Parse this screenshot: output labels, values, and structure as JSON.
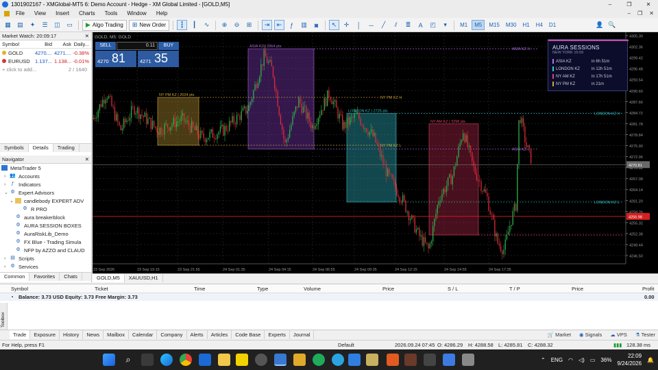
{
  "window": {
    "title": "1301902167 - XMGlobal-MT5 6: Demo Account - Hedge - XM Global Limited - [GOLD,M5]",
    "controls": [
      "–",
      "❐",
      "✕"
    ]
  },
  "menu": [
    "File",
    "View",
    "Insert",
    "Charts",
    "Tools",
    "Window",
    "Help"
  ],
  "toolbar": {
    "algo_label": "Algo Trading",
    "new_order_label": "New Order",
    "timeframes": [
      "M1",
      "M5",
      "M15",
      "M30",
      "H1",
      "H4",
      "D1"
    ],
    "active_tf": "M5"
  },
  "market_watch": {
    "title": "Market Watch: 20:09:17",
    "headers": [
      "Symbol",
      "Bid",
      "Ask",
      "Daily..."
    ],
    "rows": [
      {
        "symbol": "GOLD",
        "bid": "4270....",
        "ask": "4271....",
        "daily": "-0.38%"
      },
      {
        "symbol": "EURUSD",
        "bid": "1.137...",
        "ask": "1.138...",
        "daily": "-0.01%"
      }
    ],
    "add_label": "+ click to add...",
    "count": "2 / 1640",
    "tabs": [
      "Symbols",
      "Details",
      "Trading"
    ]
  },
  "navigator": {
    "title": "Navigator",
    "items": [
      {
        "label": "MetaTrader 5",
        "indent": 0
      },
      {
        "label": "Accounts",
        "indent": 1
      },
      {
        "label": "Indicators",
        "indent": 1
      },
      {
        "label": "Expert Advisors",
        "indent": 1
      },
      {
        "label": "candlebody EXPERT ADV",
        "indent": 2
      },
      {
        "label": "R PRO",
        "indent": 3
      },
      {
        "label": "aura breakerblock",
        "indent": 2
      },
      {
        "label": "AURA SESSION BOXES",
        "indent": 2
      },
      {
        "label": "AuraRiskLib_Demo",
        "indent": 2
      },
      {
        "label": "FX Blue - Trading Simula",
        "indent": 2
      },
      {
        "label": "NFP by AZZO and CLAUD",
        "indent": 2
      },
      {
        "label": "Scripts",
        "indent": 1
      },
      {
        "label": "Services",
        "indent": 1
      }
    ],
    "tabs": [
      "Common",
      "Favorites",
      "Chats"
    ]
  },
  "chart": {
    "symbol_label": "GOLD, M5:  GOLD",
    "sell_label": "SELL",
    "buy_label": "BUY",
    "lot": "0.11",
    "sell_price_small": "4270",
    "sell_price_big": "81",
    "buy_price_small": "4271",
    "buy_price_big": "35",
    "price_ticks": [
      "4305.30",
      "4302.36",
      "4299.42",
      "4296.48",
      "4293.54",
      "4290.60",
      "4287.66",
      "4284.72",
      "4281.78",
      "4278.84",
      "4275.90",
      "4272.96",
      "4270.02",
      "4267.08",
      "4264.14",
      "4261.20",
      "4258.26",
      "4255.32",
      "4252.38",
      "4249.44",
      "4246.50"
    ],
    "current_price": "4270.81",
    "red_price": "4256.98",
    "time_ticks": [
      "23 Sep 2026",
      "23 Sep 19:15",
      "23 Sep 21:55",
      "24 Sep 01:35",
      "24 Sep 04:15",
      "24 Sep 06:55",
      "24 Sep 09:35",
      "24 Sep 12:15",
      "24 Sep 14:55",
      "24 Sep 17:35"
    ],
    "sessions": [
      {
        "label": "NY PM KZ | 2024 pts",
        "color": "#d4a93a"
      },
      {
        "label": "ASIA KZ | 2954 pts",
        "color": "#a86ad8"
      },
      {
        "label": "LONDON KZ | 2725 pts",
        "color": "#33c2c7"
      },
      {
        "label": "NY AM KZ | 3298 pts",
        "color": "#e0456a"
      }
    ],
    "lines": [
      "NY PM KZ H",
      "NY PM KZ L",
      "ASIA KZ H",
      "LONDON KZ H",
      "LONDON KZ L",
      "ASIA KZ L"
    ],
    "panel": {
      "title": "AURA SESSIONS",
      "subtitle": "NEW YORK 15:09",
      "rows": [
        {
          "name": "ASIA KZ",
          "time": "in 6h 51m",
          "color": "#b76ef0"
        },
        {
          "name": "LONDON KZ",
          "time": "in 12h 51m",
          "color": "#3cc9d0"
        },
        {
          "name": "NY AM KZ",
          "time": "in 17h 51m",
          "color": "#e0456a"
        },
        {
          "name": "NY PM KZ",
          "time": "in 21m",
          "color": "#d4a93a"
        }
      ]
    }
  },
  "chart_tabs": [
    "GOLD,M5",
    "XAUUSD,H1"
  ],
  "terminal": {
    "headers": [
      "Symbol",
      "Ticket",
      "Time",
      "Type",
      "Volume",
      "Price",
      "S / L",
      "T / P",
      "Price",
      "Profit"
    ],
    "balance": "Balance: 3.73 USD  Equity: 3.73  Free Margin: 3.73",
    "profit": "0.00",
    "tabs": [
      "Trade",
      "Exposure",
      "History",
      "News",
      "Mailbox",
      "Calendar",
      "Company",
      "Alerts",
      "Articles",
      "Code Base",
      "Experts",
      "Journal"
    ],
    "right": [
      "Market",
      "Signals",
      "VPS",
      "Tester"
    ],
    "side_label": "Toolbox"
  },
  "status": {
    "help": "For Help, press F1",
    "profile": "Default",
    "time": "2026.09.24 07:45",
    "o": "O: 4286.29",
    "h": "H: 4288.58",
    "l": "L: 4285.81",
    "c": "C: 4288.32",
    "ping": "128.38 ms"
  },
  "taskbar": {
    "lang": "ENG",
    "battery": "36%",
    "time": "22:09",
    "date": "9/24/2026"
  }
}
